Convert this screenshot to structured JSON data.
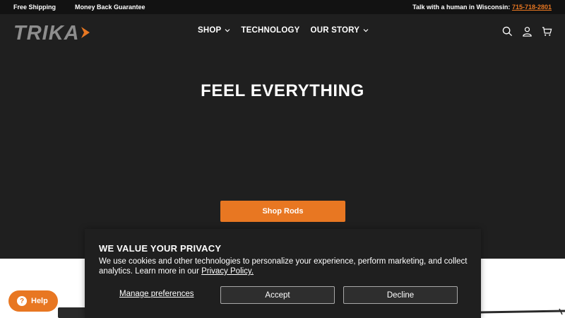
{
  "topbar": {
    "free_shipping": "Free Shipping",
    "money_back": "Money Back Guarantee",
    "talk_label": "Talk with a human in Wisconsin:",
    "phone": "715-718-2801"
  },
  "header": {
    "brand": "TRIKA",
    "nav": [
      {
        "label": "SHOP",
        "has_dropdown": true
      },
      {
        "label": "TECHNOLOGY",
        "has_dropdown": false
      },
      {
        "label": "OUR STORY",
        "has_dropdown": true
      }
    ],
    "icons": [
      "search-icon",
      "account-icon",
      "cart-icon"
    ]
  },
  "hero": {
    "title": "FEEL EVERYTHING",
    "cta": "Shop Rods"
  },
  "cookie_banner": {
    "title": "WE VALUE YOUR PRIVACY",
    "text": "We use cookies and other technologies to personalize your experience, perform marketing, and collect analytics. Learn more in our ",
    "link": "Privacy Policy.",
    "manage": "Manage preferences",
    "accept": "Accept",
    "decline": "Decline"
  },
  "help": {
    "label": "Help"
  },
  "colors": {
    "accent": "#e87722",
    "background": "#1f1f1f",
    "topbar": "#121212"
  }
}
